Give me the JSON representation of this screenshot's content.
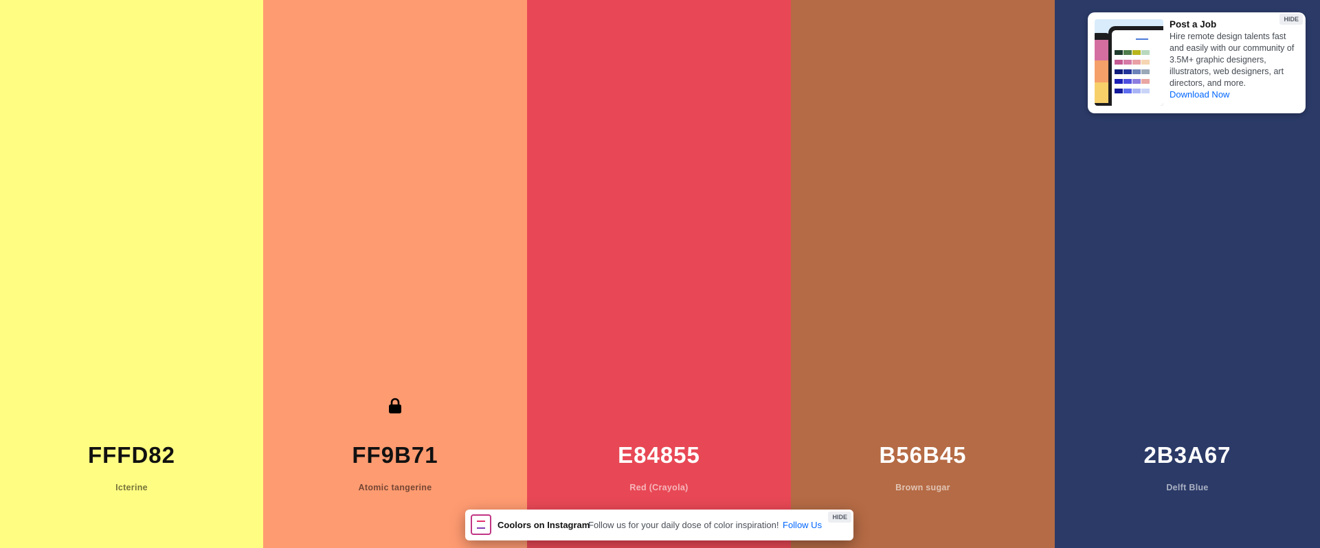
{
  "palette": {
    "colors": [
      {
        "hex": "FFFD82",
        "name": "Icterine",
        "swatch_color": "#FFFD82",
        "text_tone": "dark",
        "locked": false
      },
      {
        "hex": "FF9B71",
        "name": "Atomic tangerine",
        "swatch_color": "#FF9B71",
        "text_tone": "dark",
        "locked": true
      },
      {
        "hex": "E84855",
        "name": "Red (Crayola)",
        "swatch_color": "#E84855",
        "text_tone": "light",
        "locked": false
      },
      {
        "hex": "B56B45",
        "name": "Brown sugar",
        "swatch_color": "#B56B45",
        "text_tone": "light",
        "locked": false
      },
      {
        "hex": "2B3A67",
        "name": "Delft Blue",
        "swatch_color": "#2B3A67",
        "text_tone": "light",
        "locked": false
      }
    ],
    "lock_icon": "lock-icon"
  },
  "ad": {
    "title": "Post a Job",
    "text": "Hire remote design talents fast and easily with our community of 3.5M+ graphic designers, illustrators, web designers, art directors, and more.",
    "link": "Download Now",
    "hide_label": "HIDE"
  },
  "instagram_banner": {
    "title": "Coolors on Instagram",
    "text": "Follow us for your daily dose of color inspiration!",
    "link": "Follow Us",
    "hide_label": "HIDE",
    "logo_icon": "instagram-logo-icon"
  },
  "colors": {
    "link": "#0066ff"
  }
}
